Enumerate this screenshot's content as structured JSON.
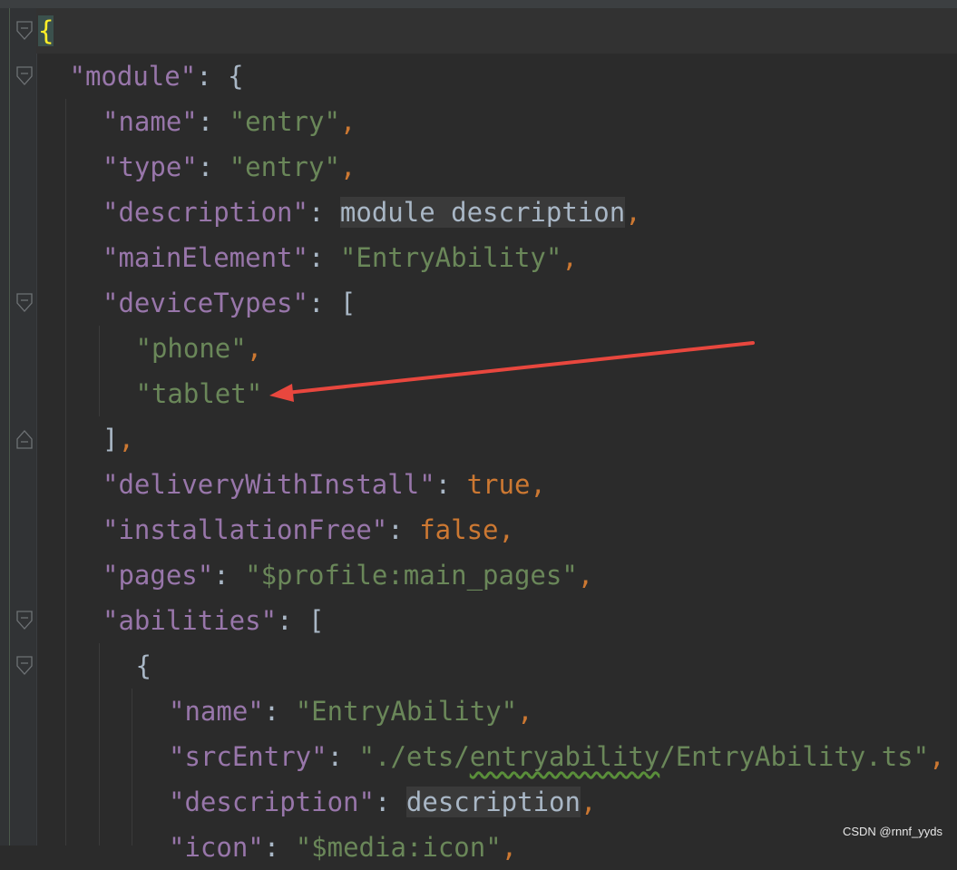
{
  "editor": {
    "language": "json",
    "lines": [
      {
        "indent": 0,
        "parts": [
          {
            "t": "{",
            "c": "brace-hl"
          }
        ]
      },
      {
        "indent": 1,
        "parts": [
          {
            "t": "\"module\"",
            "c": "k"
          },
          {
            "t": ": {",
            "c": "w"
          }
        ]
      },
      {
        "indent": 2,
        "parts": [
          {
            "t": "\"name\"",
            "c": "k"
          },
          {
            "t": ": ",
            "c": "w"
          },
          {
            "t": "\"entry\"",
            "c": "s"
          },
          {
            "t": ",",
            "c": "p"
          }
        ]
      },
      {
        "indent": 2,
        "parts": [
          {
            "t": "\"type\"",
            "c": "k"
          },
          {
            "t": ": ",
            "c": "w"
          },
          {
            "t": "\"entry\"",
            "c": "s"
          },
          {
            "t": ",",
            "c": "p"
          }
        ]
      },
      {
        "indent": 2,
        "parts": [
          {
            "t": "\"description\"",
            "c": "k"
          },
          {
            "t": ": ",
            "c": "w"
          },
          {
            "t": "module description",
            "c": "v"
          },
          {
            "t": ",",
            "c": "p"
          }
        ]
      },
      {
        "indent": 2,
        "parts": [
          {
            "t": "\"mainElement\"",
            "c": "k"
          },
          {
            "t": ": ",
            "c": "w"
          },
          {
            "t": "\"EntryAbility\"",
            "c": "s"
          },
          {
            "t": ",",
            "c": "p"
          }
        ]
      },
      {
        "indent": 2,
        "parts": [
          {
            "t": "\"deviceTypes\"",
            "c": "k"
          },
          {
            "t": ": [",
            "c": "w"
          }
        ]
      },
      {
        "indent": 3,
        "parts": [
          {
            "t": "\"phone\"",
            "c": "s"
          },
          {
            "t": ",",
            "c": "p"
          }
        ]
      },
      {
        "indent": 3,
        "parts": [
          {
            "t": "\"tablet\"",
            "c": "s"
          }
        ]
      },
      {
        "indent": 2,
        "parts": [
          {
            "t": "]",
            "c": "w"
          },
          {
            "t": ",",
            "c": "p"
          }
        ]
      },
      {
        "indent": 2,
        "parts": [
          {
            "t": "\"deliveryWithInstall\"",
            "c": "k"
          },
          {
            "t": ": ",
            "c": "w"
          },
          {
            "t": "true",
            "c": "b"
          },
          {
            "t": ",",
            "c": "p"
          }
        ]
      },
      {
        "indent": 2,
        "parts": [
          {
            "t": "\"installationFree\"",
            "c": "k"
          },
          {
            "t": ": ",
            "c": "w"
          },
          {
            "t": "false",
            "c": "b"
          },
          {
            "t": ",",
            "c": "p"
          }
        ]
      },
      {
        "indent": 2,
        "parts": [
          {
            "t": "\"pages\"",
            "c": "k"
          },
          {
            "t": ": ",
            "c": "w"
          },
          {
            "t": "\"$profile:main_pages\"",
            "c": "s"
          },
          {
            "t": ",",
            "c": "p"
          }
        ]
      },
      {
        "indent": 2,
        "parts": [
          {
            "t": "\"abilities\"",
            "c": "k"
          },
          {
            "t": ": [",
            "c": "w"
          }
        ]
      },
      {
        "indent": 3,
        "parts": [
          {
            "t": "{",
            "c": "w"
          }
        ]
      },
      {
        "indent": 4,
        "parts": [
          {
            "t": "\"name\"",
            "c": "k"
          },
          {
            "t": ": ",
            "c": "w"
          },
          {
            "t": "\"EntryAbility\"",
            "c": "s"
          },
          {
            "t": ",",
            "c": "p"
          }
        ]
      },
      {
        "indent": 4,
        "parts": [
          {
            "t": "\"srcEntry\"",
            "c": "k"
          },
          {
            "t": ": ",
            "c": "w"
          },
          {
            "t": "\"./ets/",
            "c": "s"
          },
          {
            "t": "entryability",
            "c": "s squig"
          },
          {
            "t": "/EntryAbility.ts\"",
            "c": "s"
          },
          {
            "t": ",",
            "c": "p"
          }
        ]
      },
      {
        "indent": 4,
        "parts": [
          {
            "t": "\"description\"",
            "c": "k"
          },
          {
            "t": ": ",
            "c": "w"
          },
          {
            "t": "description",
            "c": "v"
          },
          {
            "t": ",",
            "c": "p"
          }
        ]
      },
      {
        "indent": 4,
        "parts": [
          {
            "t": "\"icon\"",
            "c": "k"
          },
          {
            "t": ": ",
            "c": "w"
          },
          {
            "t": "\"$media:icon\"",
            "c": "s"
          },
          {
            "t": ",",
            "c": "p"
          }
        ]
      }
    ],
    "folds": [
      {
        "line": 0,
        "kind": "open"
      },
      {
        "line": 1,
        "kind": "open"
      },
      {
        "line": 6,
        "kind": "open"
      },
      {
        "line": 9,
        "kind": "close"
      },
      {
        "line": 13,
        "kind": "open"
      },
      {
        "line": 14,
        "kind": "open"
      }
    ],
    "annotation": {
      "color": "#e8473e",
      "points_to_line": 8
    }
  },
  "watermark": "CSDN @rnnf_yyds"
}
